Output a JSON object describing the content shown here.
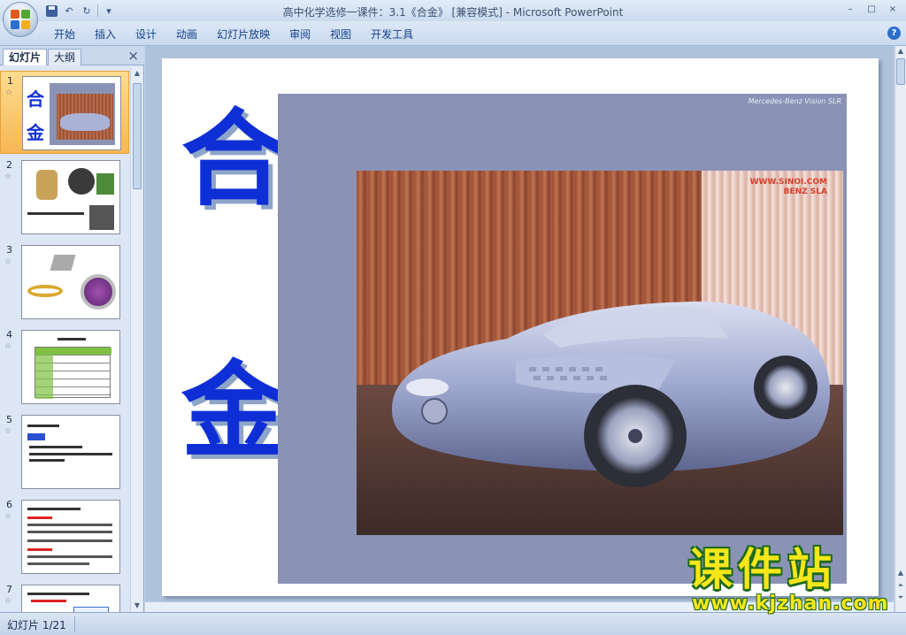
{
  "window": {
    "title": "高中化学选修一课件：3.1《合金》 [兼容模式] - Microsoft PowerPoint",
    "controls": [
      "–",
      "□",
      "×"
    ]
  },
  "quick_access": [
    "save-icon",
    "undo-icon",
    "redo-icon",
    "customize-icon"
  ],
  "ribbon": {
    "tabs": [
      "开始",
      "插入",
      "设计",
      "动画",
      "幻灯片放映",
      "审阅",
      "视图",
      "开发工具"
    ],
    "help": "?"
  },
  "left_pane": {
    "tab_slides": "幻灯片",
    "tab_outline": "大纲",
    "close": "×",
    "thumbnails": [
      {
        "num": "1",
        "selected": true
      },
      {
        "num": "2"
      },
      {
        "num": "3"
      },
      {
        "num": "4"
      },
      {
        "num": "5"
      },
      {
        "num": "6"
      },
      {
        "num": "7"
      }
    ]
  },
  "slide": {
    "title_char_1": "合",
    "title_char_2": "金",
    "photo_caption": "Mercedes-Benz Vision SLR",
    "photo_watermark_1": "WWW.SINOI.COM",
    "photo_watermark_2": "BENZ SLA"
  },
  "status": {
    "slide_indicator": "幻灯片 1/21"
  },
  "site_logo": {
    "name": "课件站",
    "url": "www.kjzhan.com"
  },
  "colors": {
    "title_blue": "#0f2fd6",
    "ribbon_text": "#15428b",
    "logo_yellow": "#f7e61a",
    "logo_green": "#1d6a1e"
  }
}
